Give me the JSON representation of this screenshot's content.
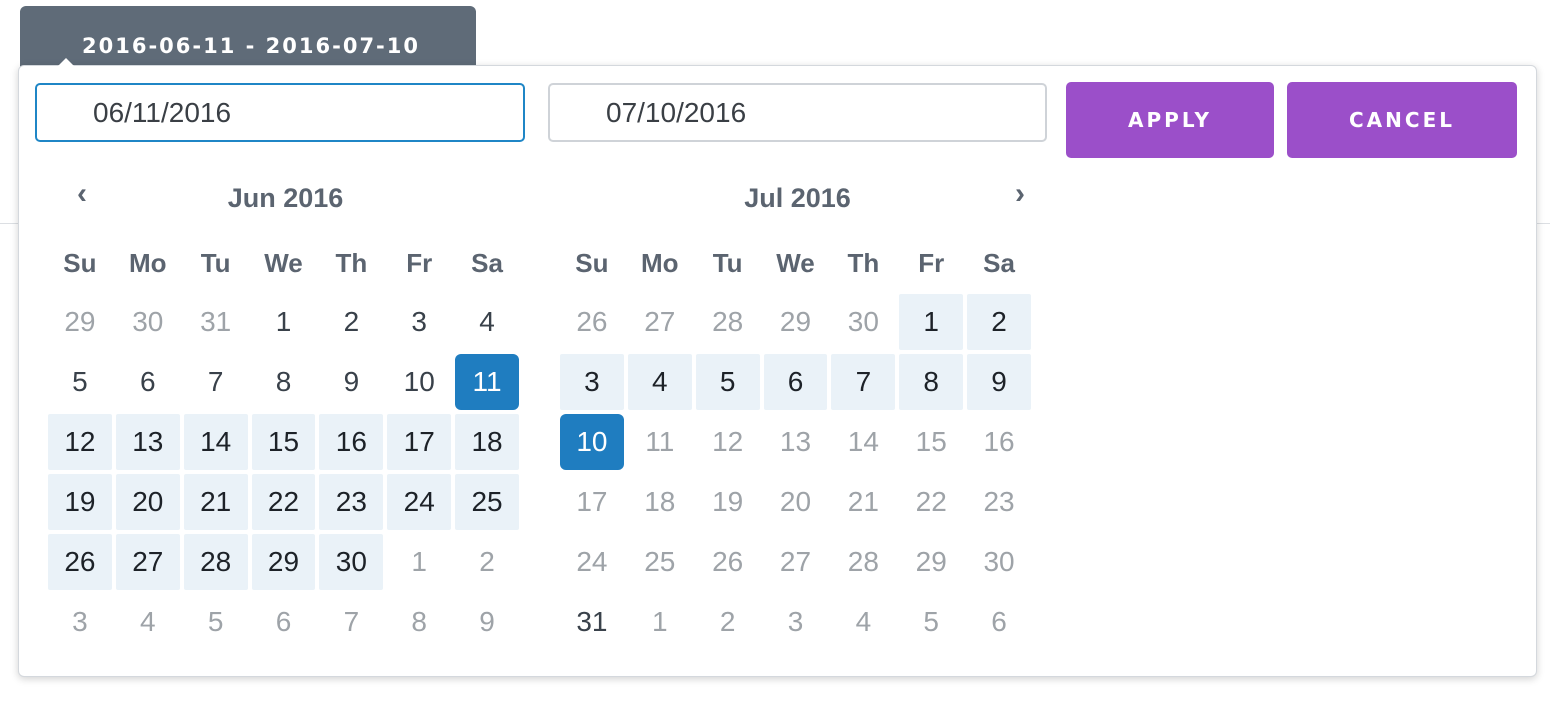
{
  "toggle": {
    "label": "2016-06-11 - 2016-07-10"
  },
  "inputs": {
    "start_value": "06/11/2016",
    "end_value": "07/10/2016"
  },
  "buttons": {
    "apply": "APPLY",
    "cancel": "CANCEL"
  },
  "nav": {
    "prev_icon": "chevron-left-icon",
    "next_icon": "chevron-right-icon",
    "prev_glyph": "‹",
    "next_glyph": "›"
  },
  "colors": {
    "toggle_bg": "#5f6b78",
    "button_bg": "#9b4fc9",
    "selected_bg": "#1f7dc0",
    "range_bg": "#eaf2f8",
    "focus_border": "#1f86c6"
  },
  "weekdays": [
    "Su",
    "Mo",
    "Tu",
    "We",
    "Th",
    "Fr",
    "Sa"
  ],
  "months": [
    {
      "title": "Jun 2016",
      "weeks": [
        [
          {
            "d": "29",
            "s": "off"
          },
          {
            "d": "30",
            "s": "off"
          },
          {
            "d": "31",
            "s": "off"
          },
          {
            "d": "1",
            "s": ""
          },
          {
            "d": "2",
            "s": ""
          },
          {
            "d": "3",
            "s": ""
          },
          {
            "d": "4",
            "s": ""
          }
        ],
        [
          {
            "d": "5",
            "s": ""
          },
          {
            "d": "6",
            "s": ""
          },
          {
            "d": "7",
            "s": ""
          },
          {
            "d": "8",
            "s": ""
          },
          {
            "d": "9",
            "s": ""
          },
          {
            "d": "10",
            "s": ""
          },
          {
            "d": "11",
            "s": "selected"
          }
        ],
        [
          {
            "d": "12",
            "s": "in-range"
          },
          {
            "d": "13",
            "s": "in-range"
          },
          {
            "d": "14",
            "s": "in-range"
          },
          {
            "d": "15",
            "s": "in-range"
          },
          {
            "d": "16",
            "s": "in-range"
          },
          {
            "d": "17",
            "s": "in-range"
          },
          {
            "d": "18",
            "s": "in-range"
          }
        ],
        [
          {
            "d": "19",
            "s": "in-range"
          },
          {
            "d": "20",
            "s": "in-range"
          },
          {
            "d": "21",
            "s": "in-range"
          },
          {
            "d": "22",
            "s": "in-range"
          },
          {
            "d": "23",
            "s": "in-range"
          },
          {
            "d": "24",
            "s": "in-range"
          },
          {
            "d": "25",
            "s": "in-range"
          }
        ],
        [
          {
            "d": "26",
            "s": "in-range"
          },
          {
            "d": "27",
            "s": "in-range"
          },
          {
            "d": "28",
            "s": "in-range"
          },
          {
            "d": "29",
            "s": "in-range"
          },
          {
            "d": "30",
            "s": "in-range"
          },
          {
            "d": "1",
            "s": "off"
          },
          {
            "d": "2",
            "s": "off"
          }
        ],
        [
          {
            "d": "3",
            "s": "off"
          },
          {
            "d": "4",
            "s": "off"
          },
          {
            "d": "5",
            "s": "off"
          },
          {
            "d": "6",
            "s": "off"
          },
          {
            "d": "7",
            "s": "off"
          },
          {
            "d": "8",
            "s": "off"
          },
          {
            "d": "9",
            "s": "off"
          }
        ]
      ]
    },
    {
      "title": "Jul 2016",
      "weeks": [
        [
          {
            "d": "26",
            "s": "off"
          },
          {
            "d": "27",
            "s": "off"
          },
          {
            "d": "28",
            "s": "off"
          },
          {
            "d": "29",
            "s": "off"
          },
          {
            "d": "30",
            "s": "off"
          },
          {
            "d": "1",
            "s": "in-range"
          },
          {
            "d": "2",
            "s": "in-range"
          }
        ],
        [
          {
            "d": "3",
            "s": "in-range"
          },
          {
            "d": "4",
            "s": "in-range"
          },
          {
            "d": "5",
            "s": "in-range"
          },
          {
            "d": "6",
            "s": "in-range"
          },
          {
            "d": "7",
            "s": "in-range"
          },
          {
            "d": "8",
            "s": "in-range"
          },
          {
            "d": "9",
            "s": "in-range"
          }
        ],
        [
          {
            "d": "10",
            "s": "selected"
          },
          {
            "d": "11",
            "s": "off"
          },
          {
            "d": "12",
            "s": "off"
          },
          {
            "d": "13",
            "s": "off"
          },
          {
            "d": "14",
            "s": "off"
          },
          {
            "d": "15",
            "s": "off"
          },
          {
            "d": "16",
            "s": "off"
          }
        ],
        [
          {
            "d": "17",
            "s": "off"
          },
          {
            "d": "18",
            "s": "off"
          },
          {
            "d": "19",
            "s": "off"
          },
          {
            "d": "20",
            "s": "off"
          },
          {
            "d": "21",
            "s": "off"
          },
          {
            "d": "22",
            "s": "off"
          },
          {
            "d": "23",
            "s": "off"
          }
        ],
        [
          {
            "d": "24",
            "s": "off"
          },
          {
            "d": "25",
            "s": "off"
          },
          {
            "d": "26",
            "s": "off"
          },
          {
            "d": "27",
            "s": "off"
          },
          {
            "d": "28",
            "s": "off"
          },
          {
            "d": "29",
            "s": "off"
          },
          {
            "d": "30",
            "s": "off"
          }
        ],
        [
          {
            "d": "31",
            "s": ""
          },
          {
            "d": "1",
            "s": "off"
          },
          {
            "d": "2",
            "s": "off"
          },
          {
            "d": "3",
            "s": "off"
          },
          {
            "d": "4",
            "s": "off"
          },
          {
            "d": "5",
            "s": "off"
          },
          {
            "d": "6",
            "s": "off"
          }
        ]
      ]
    }
  ]
}
